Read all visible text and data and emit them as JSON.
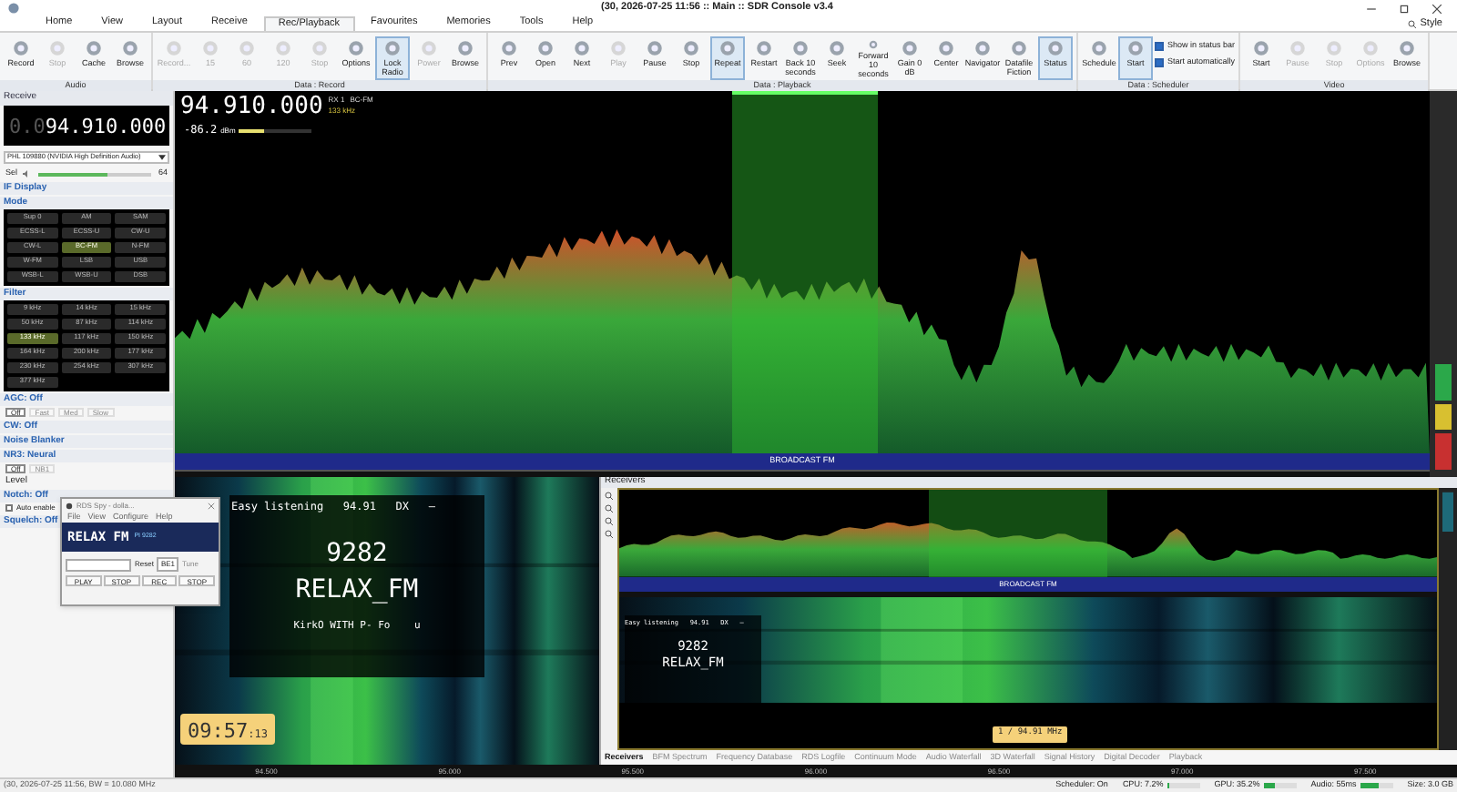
{
  "window": {
    "title": "(30, 2026-07-25 11:56 :: Main :: SDR Console v3.4",
    "style_label": "Style"
  },
  "ribbon_tabs": [
    {
      "label": "Home",
      "selected": false
    },
    {
      "label": "View",
      "selected": false
    },
    {
      "label": "Layout",
      "selected": false
    },
    {
      "label": "Receive",
      "selected": false
    },
    {
      "label": "Rec/Playback",
      "selected": true
    },
    {
      "label": "Favourites",
      "selected": false
    },
    {
      "label": "Memories",
      "selected": false
    },
    {
      "label": "Tools",
      "selected": false
    },
    {
      "label": "Help",
      "selected": false
    }
  ],
  "ribbon_groups": [
    {
      "title": "Audio",
      "buttons": [
        {
          "label": "Record",
          "disabled": false,
          "selected": false
        },
        {
          "label": "Stop",
          "disabled": true,
          "selected": false
        },
        {
          "label": "Cache",
          "disabled": false,
          "selected": false
        },
        {
          "label": "Browse",
          "disabled": false,
          "selected": false
        }
      ]
    },
    {
      "title": "Data : Record",
      "buttons": [
        {
          "label": "Record...",
          "disabled": true,
          "selected": false
        },
        {
          "label": "15",
          "disabled": true,
          "selected": false
        },
        {
          "label": "60",
          "disabled": true,
          "selected": false
        },
        {
          "label": "120",
          "disabled": true,
          "selected": false
        },
        {
          "label": "Stop",
          "disabled": true,
          "selected": false
        },
        {
          "label": "Options",
          "disabled": false,
          "selected": false
        },
        {
          "label": "Lock Radio",
          "disabled": false,
          "selected": true
        },
        {
          "label": "Power",
          "disabled": true,
          "selected": false
        },
        {
          "label": "Browse",
          "disabled": false,
          "selected": false
        }
      ]
    },
    {
      "title": "Data : Playback",
      "buttons": [
        {
          "label": "Prev",
          "disabled": false,
          "selected": false
        },
        {
          "label": "Open",
          "disabled": false,
          "selected": false
        },
        {
          "label": "Next",
          "disabled": false,
          "selected": false
        },
        {
          "label": "Play",
          "disabled": true,
          "selected": false
        },
        {
          "label": "Pause",
          "disabled": false,
          "selected": false
        },
        {
          "label": "Stop",
          "disabled": false,
          "selected": false
        },
        {
          "label": "Repeat",
          "disabled": false,
          "selected": true
        },
        {
          "label": "Restart",
          "disabled": false,
          "selected": false
        },
        {
          "label": "Back 10 seconds",
          "disabled": false,
          "selected": false
        },
        {
          "label": "Seek",
          "disabled": false,
          "selected": false
        },
        {
          "label": "Forward 10 seconds",
          "disabled": false,
          "selected": false
        },
        {
          "label": "Gain 0 dB",
          "disabled": false,
          "selected": false
        },
        {
          "label": "Center",
          "disabled": false,
          "selected": false
        },
        {
          "label": "Navigator",
          "disabled": false,
          "selected": false
        },
        {
          "label": "Datafile Fiction",
          "disabled": false,
          "selected": false
        },
        {
          "label": "Status",
          "disabled": false,
          "selected": true
        }
      ]
    },
    {
      "title": "Data : Scheduler",
      "buttons": [
        {
          "label": "Schedule",
          "disabled": false,
          "selected": false
        },
        {
          "label": "Start",
          "disabled": false,
          "selected": true
        }
      ],
      "options": [
        {
          "label": "Show in status bar",
          "checked": true
        },
        {
          "label": "Start automatically",
          "checked": true
        }
      ]
    },
    {
      "title": "Video",
      "buttons": [
        {
          "label": "Start",
          "disabled": false,
          "selected": false
        },
        {
          "label": "Pause",
          "disabled": true,
          "selected": false
        },
        {
          "label": "Stop",
          "disabled": true,
          "selected": false
        },
        {
          "label": "Options",
          "disabled": true,
          "selected": false
        },
        {
          "label": "Browse",
          "disabled": false,
          "selected": false
        }
      ]
    }
  ],
  "receive": {
    "title": "Receive",
    "vfo_prefix": "0.0",
    "vfo_frequency": "94.910.000",
    "audio_device": "PHL 109880 (NVIDIA High Definition Audio)",
    "volume": {
      "label": "Sel",
      "level": 0.62,
      "reading": "64"
    },
    "if_display": "IF Display",
    "mode": {
      "title": "Mode",
      "buttons": [
        {
          "label": "Sup 0",
          "selected": false
        },
        {
          "label": "AM",
          "selected": false
        },
        {
          "label": "SAM",
          "selected": false
        },
        {
          "label": "ECSS-L",
          "selected": false
        },
        {
          "label": "ECSS-U",
          "selected": false
        },
        {
          "label": "CW-U",
          "selected": false
        },
        {
          "label": "CW-L",
          "selected": false
        },
        {
          "label": "BC-FM",
          "selected": true
        },
        {
          "label": "N-FM",
          "selected": false
        },
        {
          "label": "W-FM",
          "selected": false
        },
        {
          "label": "LSB",
          "selected": false
        },
        {
          "label": "USB",
          "selected": false
        },
        {
          "label": "WSB-L",
          "selected": false
        },
        {
          "label": "WSB-U",
          "selected": false
        },
        {
          "label": "DSB",
          "selected": false
        }
      ]
    },
    "filter": {
      "title": "Filter",
      "buttons": [
        {
          "label": "9 kHz",
          "selected": false
        },
        {
          "label": "14 kHz",
          "selected": false
        },
        {
          "label": "15 kHz",
          "selected": false
        },
        {
          "label": "50 kHz",
          "selected": false
        },
        {
          "label": "87 kHz",
          "selected": false
        },
        {
          "label": "114 kHz",
          "selected": false
        },
        {
          "label": "133 kHz",
          "selected": true
        },
        {
          "label": "117 kHz",
          "selected": false
        },
        {
          "label": "150 kHz",
          "selected": false
        },
        {
          "label": "164 kHz",
          "selected": false
        },
        {
          "label": "200 kHz",
          "selected": false
        },
        {
          "label": "177 kHz",
          "selected": false
        },
        {
          "label": "230 kHz",
          "selected": false
        },
        {
          "label": "254 kHz",
          "selected": false
        },
        {
          "label": "307 kHz",
          "selected": false
        },
        {
          "label": "377 kHz",
          "selected": false
        }
      ]
    },
    "agc": {
      "title": "AGC: Off",
      "buttons": [
        {
          "label": "Off",
          "selected": true
        },
        {
          "label": "Fast",
          "selected": false
        },
        {
          "label": "Med",
          "selected": false
        },
        {
          "label": "Slow",
          "selected": false
        }
      ]
    },
    "cw": "CW: Off",
    "noise_blanker": "Noise Blanker",
    "nr": {
      "title": "NR3: Neural",
      "buttons": [
        {
          "label": "Off",
          "selected": true
        },
        {
          "label": "NB1",
          "selected": false
        }
      ],
      "level_label": "Level"
    },
    "notch": {
      "title": "Notch: Off",
      "auto_enable": {
        "label": "Auto enable",
        "checked": false
      }
    },
    "squelch": "Squelch: Off"
  },
  "spectrum": {
    "frequency": "94.910.000",
    "receiver": "RX 1",
    "mode": "BC-FM",
    "bandwidth": "133 kHz",
    "signal": "-86.2",
    "signal_unit": "dBm",
    "signal_meter": {
      "level": 0.35
    },
    "band": "BROADCAST FM"
  },
  "rds_display": {
    "line_1": "Easy listening   94.91   DX   –",
    "pi": "9282",
    "station": "RELAX_FM",
    "radiotext": "KirkO WITH P- Fo    u",
    "clock": "09:57",
    "clock_seconds": ":13"
  },
  "rds_spy": {
    "title": "RDS Spy - dolla...",
    "menu": [
      "File",
      "View",
      "Configure",
      "Help"
    ],
    "station": "RELAX FM",
    "pi": "PI 9282",
    "reset": "Reset",
    "group": "BE1",
    "tune": "Tune",
    "buttons": [
      "PLAY",
      "STOP",
      "REC",
      "STOP"
    ]
  },
  "receivers_panel": {
    "title": "Receivers",
    "band": "BROADCAST FM",
    "line_1": "Easy listening   94.91   DX   –",
    "pi": "9282",
    "station": "RELAX_FM",
    "marker": "1 / 94.91 MHz",
    "tabs": [
      {
        "label": "Receivers",
        "selected": true
      },
      {
        "label": "BFM Spectrum",
        "selected": false
      },
      {
        "label": "Frequency Database",
        "selected": false
      },
      {
        "label": "RDS Logfile",
        "selected": false
      },
      {
        "label": "Continuum Mode",
        "selected": false
      },
      {
        "label": "Audio Waterfall",
        "selected": false
      },
      {
        "label": "3D Waterfall",
        "selected": false
      },
      {
        "label": "Signal History",
        "selected": false
      },
      {
        "label": "Digital Decoder",
        "selected": false
      },
      {
        "label": "Playback",
        "selected": false
      }
    ]
  },
  "frequency_axis": [
    "94.500",
    "95.000",
    "95.500",
    "96.000",
    "96.500",
    "97.000",
    "97.500"
  ],
  "status_bar": {
    "left": "(30, 2026-07-25 11:56, BW = 10.080 MHz",
    "scheduler": "Scheduler: On",
    "meters": [
      {
        "label": "CPU: 7.2%",
        "level": 0.07
      },
      {
        "label": "GPU: 35.2%",
        "level": 0.35
      },
      {
        "label": "Audio: 55ms",
        "level": 0.55
      }
    ],
    "size": "Size: 3.0 GB"
  }
}
